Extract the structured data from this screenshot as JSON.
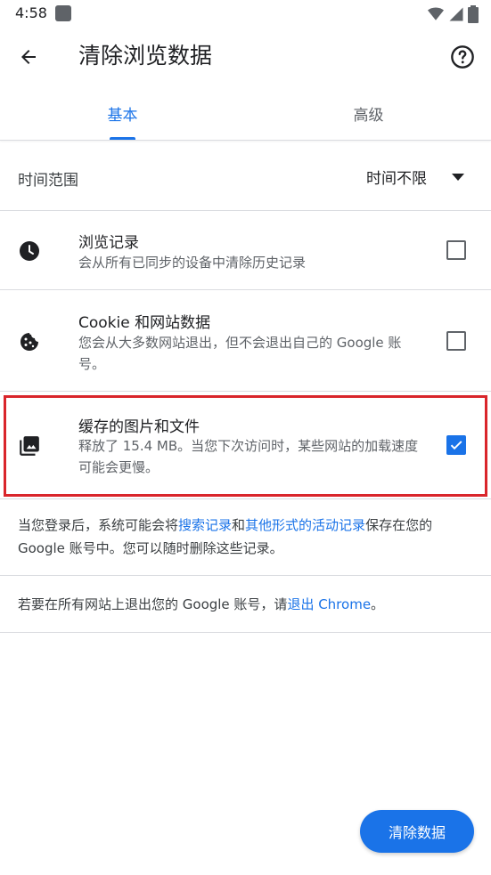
{
  "status_bar": {
    "time": "4:58"
  },
  "app_bar": {
    "title": "清除浏览数据"
  },
  "tabs": [
    {
      "label": "基本",
      "selected": true
    },
    {
      "label": "高级",
      "selected": false
    }
  ],
  "time_range": {
    "label": "时间范围",
    "value": "时间不限"
  },
  "options": [
    {
      "icon": "clock-icon",
      "title": "浏览记录",
      "description": "会从所有已同步的设备中清除历史记录",
      "checked": false
    },
    {
      "icon": "cookie-icon",
      "title": "Cookie 和网站数据",
      "description": "您会从大多数网站退出，但不会退出自己的 Google 账号。",
      "checked": false
    },
    {
      "icon": "image-stack-icon",
      "title": "缓存的图片和文件",
      "description": "释放了 15.4 MB。当您下次访问时，某些网站的加载速度可能会更慢。",
      "checked": true
    }
  ],
  "info1": {
    "text_before": "当您登录后，系统可能会将",
    "link1": "搜索记录",
    "text_mid": "和",
    "link2": "其他形式的活动记录",
    "text_after": "保存在您的 Google 账号中。您可以随时删除这些记录。"
  },
  "info2": {
    "text_before": "若要在所有网站上退出您的 Google 账号，请",
    "link": "退出 Chrome",
    "text_after": "。"
  },
  "clear_button": {
    "label": "清除数据"
  },
  "colors": {
    "accent": "#1a73e8",
    "highlight": "#d9252b"
  }
}
